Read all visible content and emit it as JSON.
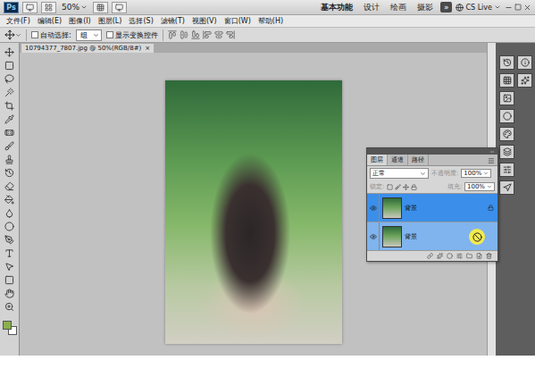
{
  "app": {
    "logo": "Ps",
    "zoom": "50%",
    "workspaces": [
      {
        "label": "基本功能",
        "selected": true
      },
      {
        "label": "设计",
        "selected": false
      },
      {
        "label": "绘画",
        "selected": false
      },
      {
        "label": "摄影",
        "selected": false
      }
    ],
    "more": "»",
    "cslive": "CS Live"
  },
  "menu": [
    "文件(F)",
    "编辑(E)",
    "图像(I)",
    "图层(L)",
    "选择(S)",
    "滤镜(T)",
    "视图(V)",
    "窗口(W)",
    "帮助(H)"
  ],
  "options": {
    "auto_select": {
      "label": "自动选择:",
      "checked": false
    },
    "auto_select_target": "组",
    "show_transform": {
      "label": "显示变换控件",
      "checked": false
    }
  },
  "colors": {
    "foreground": "#8ab04c",
    "background": "#ffffff"
  },
  "document": {
    "tab": "10794377_7807.jpg @ 50%(RGB/8#)",
    "close": "×"
  },
  "layers_panel": {
    "tabs": [
      {
        "label": "图层",
        "selected": true
      },
      {
        "label": "通道",
        "selected": false
      },
      {
        "label": "路径",
        "selected": false
      }
    ],
    "blend_mode": "正常",
    "opacity_label": "不透明度:",
    "opacity": "100%",
    "lock_label": "锁定:",
    "fill_label": "填充:",
    "fill": "100%",
    "layers": [
      {
        "name": "背景",
        "selected": true,
        "visible": true,
        "locked": true,
        "dragging": false
      },
      {
        "name": "背景",
        "selected": false,
        "visible": true,
        "locked": false,
        "dragging": true
      }
    ]
  }
}
